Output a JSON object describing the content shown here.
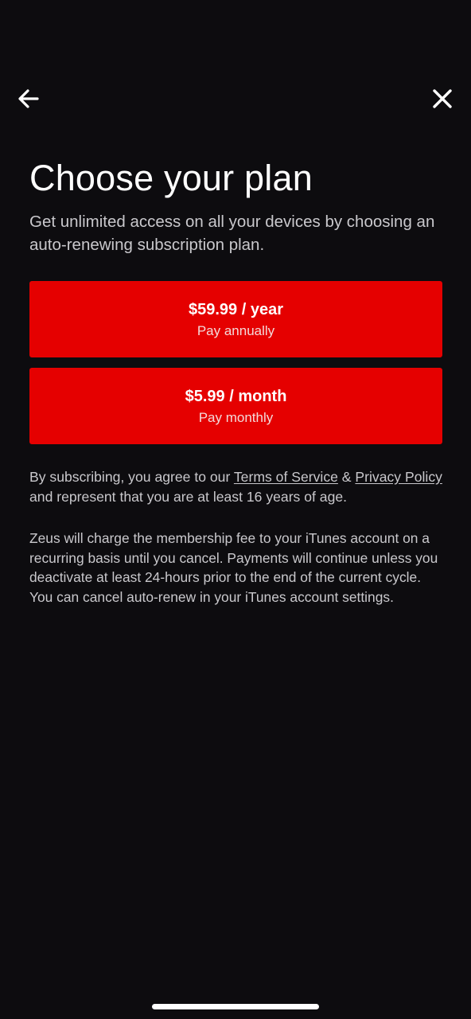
{
  "header": {
    "back_icon": "arrow-left-icon",
    "close_icon": "close-icon"
  },
  "title": "Choose your plan",
  "subtitle": "Get unlimited access on all your devices by choosing an auto-renewing subscription plan.",
  "plans": [
    {
      "price": "$59.99 / year",
      "caption": "Pay annually"
    },
    {
      "price": "$5.99 / month",
      "caption": "Pay monthly"
    }
  ],
  "terms": {
    "prefix": "By subscribing, you agree to our ",
    "tos_link": "Terms of Service",
    "joiner": " & ",
    "privacy_link": "Privacy Policy",
    "suffix": " and represent that you are at least 16 years of age."
  },
  "info": "Zeus will charge the membership fee to your iTunes account on a recurring basis until you cancel. Payments will continue unless you deactivate at least 24-hours prior to the end of the current cycle. You can cancel auto-renew in your iTunes account settings.",
  "colors": {
    "background": "#0d0c0f",
    "accent": "#e50000",
    "text_primary": "#ffffff",
    "text_secondary": "#c9c8cc"
  }
}
